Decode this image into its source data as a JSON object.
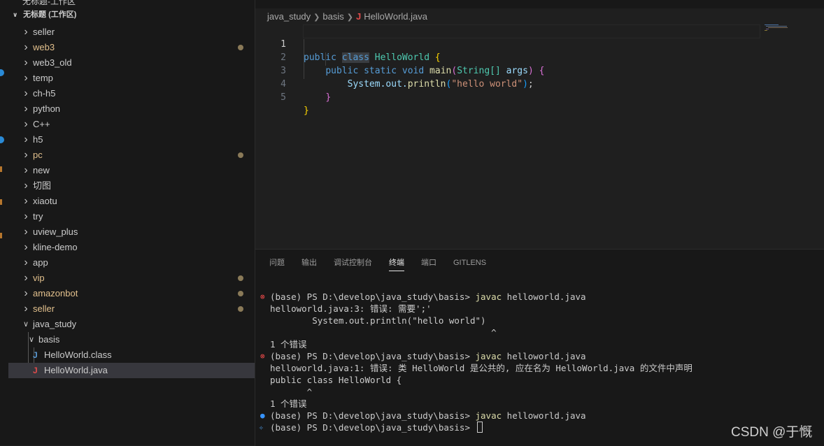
{
  "sidebar": {
    "top_text": "无标题-工作区",
    "workspace_title": "无标题 (工作区)",
    "items": [
      {
        "label": "seller",
        "modified": false
      },
      {
        "label": "web3",
        "modified": true
      },
      {
        "label": "web3_old",
        "modified": false
      },
      {
        "label": "temp",
        "modified": false
      },
      {
        "label": "ch-h5",
        "modified": false
      },
      {
        "label": "python",
        "modified": false
      },
      {
        "label": "C++",
        "modified": false
      },
      {
        "label": "h5",
        "modified": false
      },
      {
        "label": "pc",
        "modified": true
      },
      {
        "label": "new",
        "modified": false
      },
      {
        "label": "切图",
        "modified": false
      },
      {
        "label": "xiaotu",
        "modified": false
      },
      {
        "label": "try",
        "modified": false
      },
      {
        "label": "uview_plus",
        "modified": false
      },
      {
        "label": "kline-demo",
        "modified": false
      },
      {
        "label": "app",
        "modified": false
      },
      {
        "label": "vip",
        "modified": true
      },
      {
        "label": "amazonbot",
        "modified": true
      },
      {
        "label": "seller",
        "modified": true
      }
    ],
    "java_study": {
      "label": "java_study",
      "basis": {
        "label": "basis",
        "files": [
          {
            "label": "HelloWorld.class",
            "icon": "java-class-icon",
            "icon_char": "J",
            "icon_color": "#5b9bd5"
          },
          {
            "label": "HelloWorld.java",
            "icon": "java-file-icon",
            "icon_char": "J",
            "icon_color": "#e04b4b",
            "selected": true
          }
        ]
      }
    }
  },
  "editor": {
    "breadcrumb": [
      "java_study",
      "basis",
      "HelloWorld.java"
    ],
    "line_numbers": [
      "1",
      "2",
      "3",
      "4",
      "5"
    ],
    "code": {
      "l1": {
        "kw1": "public",
        "kw2": "class",
        "name": "HelloWorld",
        "brace": "{"
      },
      "l2": {
        "kw1": "public",
        "kw2": "static",
        "kw3": "void",
        "fn": "main",
        "open": "(",
        "type": "String[]",
        "param": "args",
        "close": ")",
        "brace": "{"
      },
      "l3": {
        "obj": "System.out.",
        "fn": "println",
        "open": "(",
        "str": "\"hello world\"",
        "close": ")",
        "semi": ";"
      },
      "l4": {
        "brace": "}"
      },
      "l5": {
        "brace": "}"
      }
    }
  },
  "panel": {
    "tabs": [
      "问题",
      "输出",
      "调试控制台",
      "终端",
      "端口",
      "GITLENS"
    ],
    "active_tab": "终端",
    "terminal": [
      {
        "deco": "error",
        "prompt": "(base) PS D:\\develop\\java_study\\basis> ",
        "cmd": "javac",
        "args": " helloworld.java"
      },
      {
        "text": "helloworld.java:3: 错误: 需要';'"
      },
      {
        "text": "        System.out.println(\"hello world\")"
      },
      {
        "text": "                                          ^"
      },
      {
        "text": "1 个错误"
      },
      {
        "deco": "error",
        "prompt": "(base) PS D:\\develop\\java_study\\basis> ",
        "cmd": "javac",
        "args": " helloworld.java"
      },
      {
        "text": "helloworld.java:1: 错误: 类 HelloWorld 是公共的, 应在名为 HelloWorld.java 的文件中声明"
      },
      {
        "text": "public class HelloWorld {"
      },
      {
        "text": "       ^"
      },
      {
        "text": "1 个错误"
      },
      {
        "deco": "success",
        "prompt": "(base) PS D:\\develop\\java_study\\basis> ",
        "cmd": "javac",
        "args": " helloworld.java"
      },
      {
        "deco": "sparkle",
        "prompt": "(base) PS D:\\develop\\java_study\\basis> ",
        "cursor": true
      }
    ]
  },
  "watermark": "CSDN @于慨"
}
